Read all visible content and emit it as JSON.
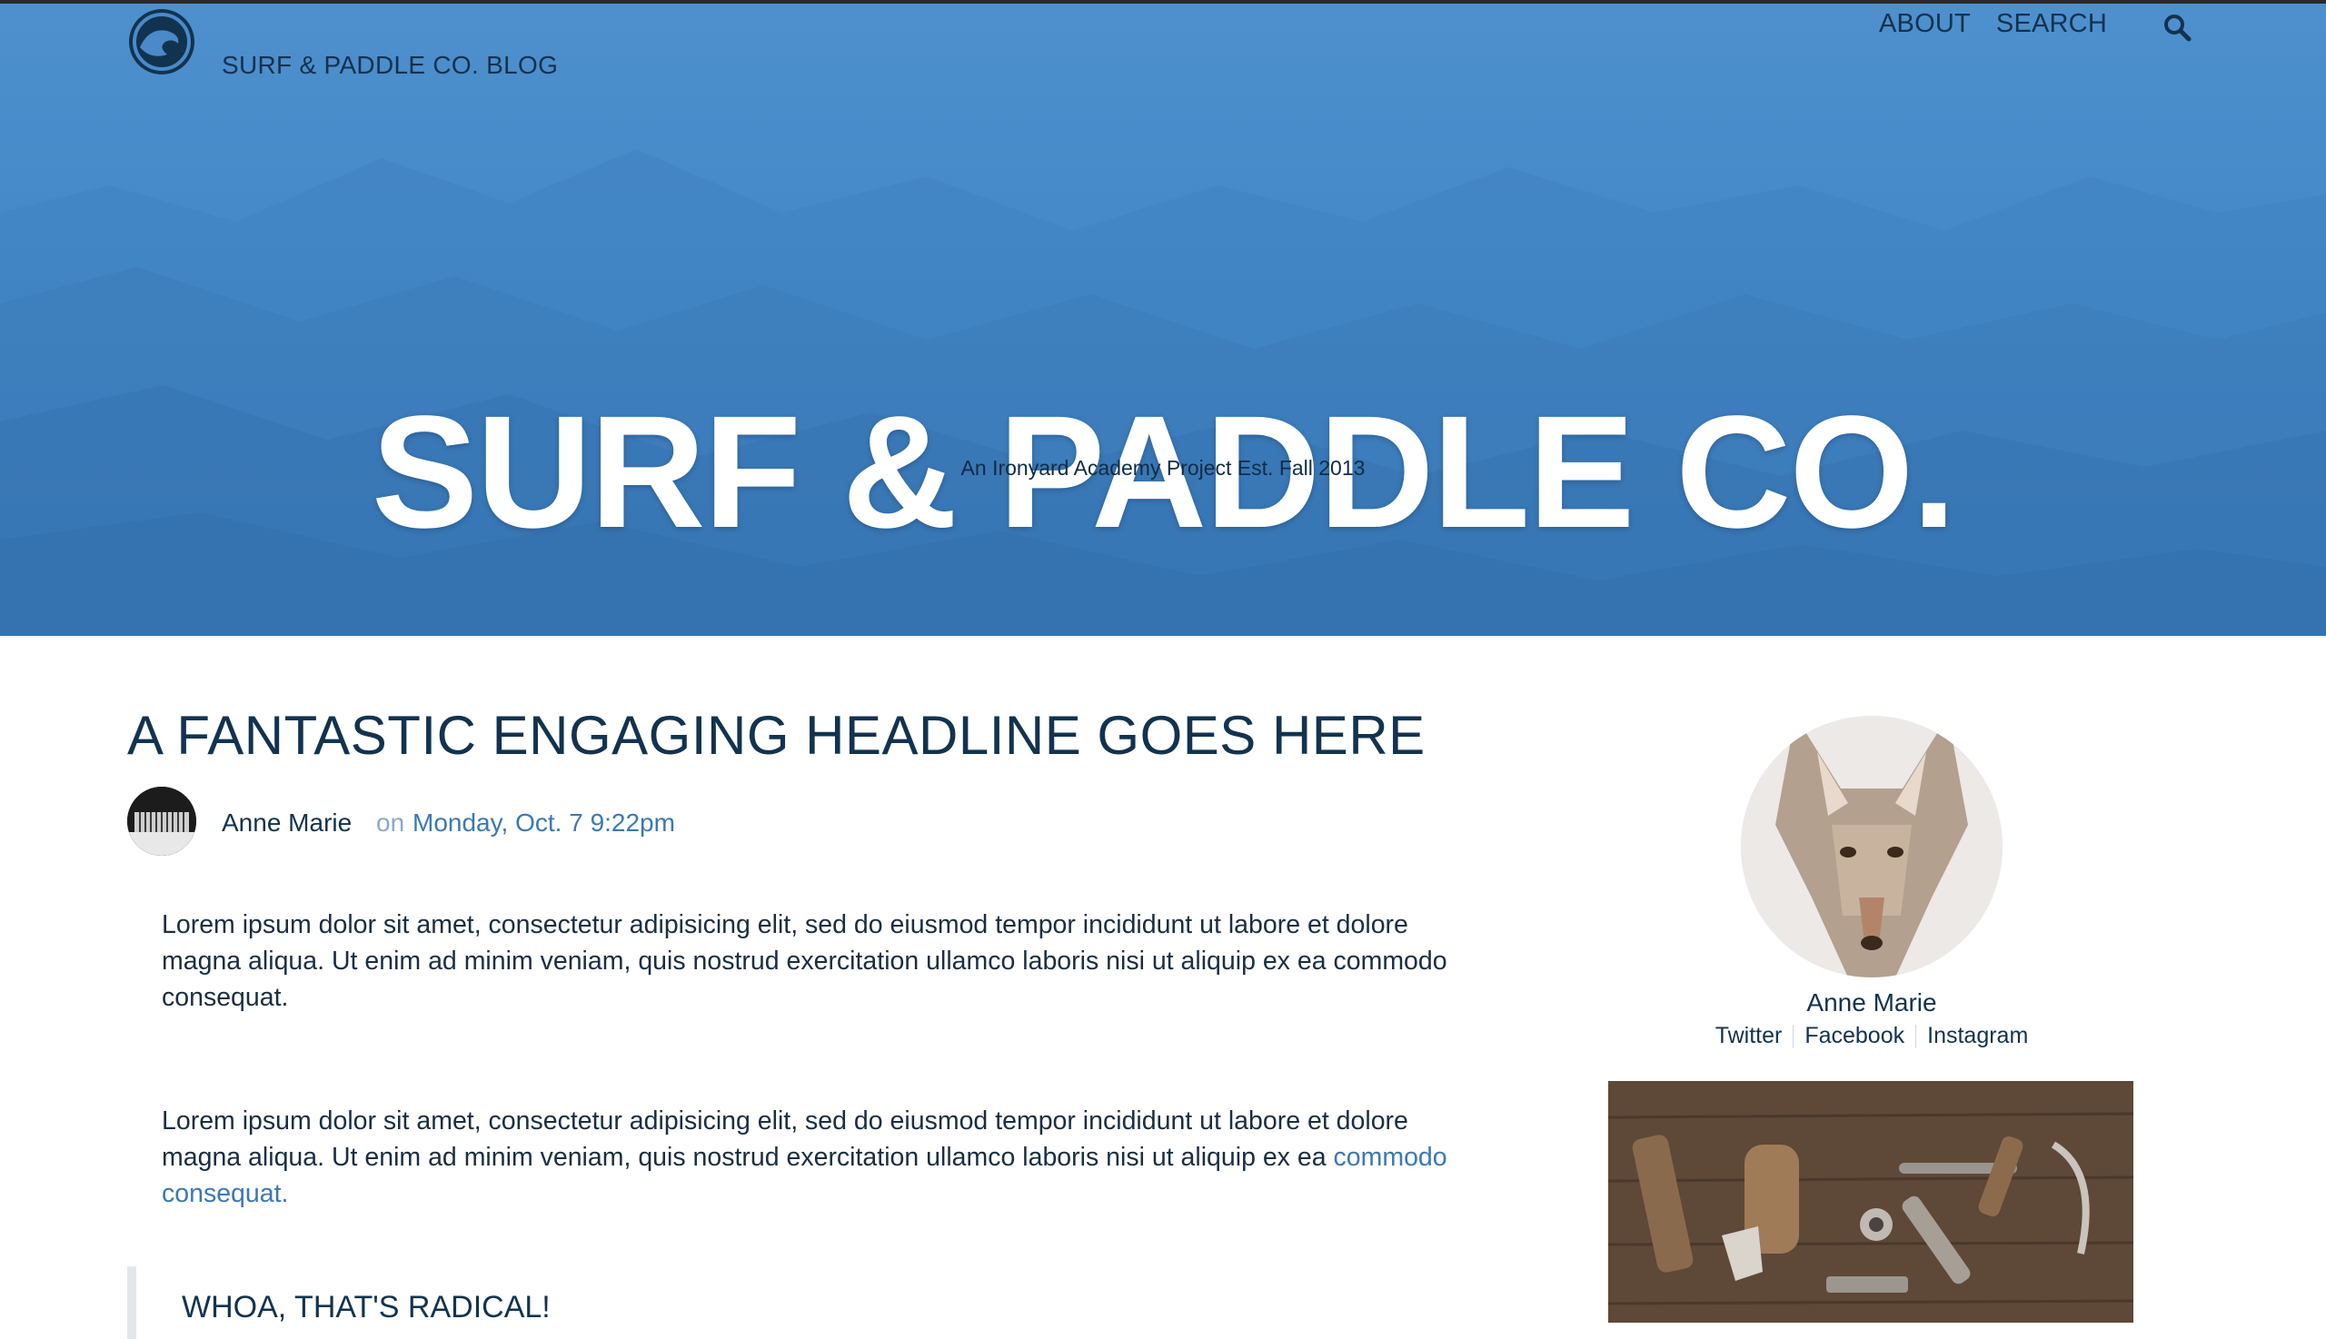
{
  "header": {
    "brand_name": "SURF & PADDLE CO. BLOG",
    "nav": [
      {
        "label": "ABOUT"
      },
      {
        "label": "SEARCH"
      }
    ],
    "search_icon": "search-icon",
    "logo_icon": "wave-logo-icon"
  },
  "hero": {
    "title": "SURF & PADDLE CO.",
    "subtitle": "An Ironyard Academy Project Est. Fall 2013"
  },
  "article": {
    "headline": "A FANTASTIC ENGAGING HEADLINE GOES HERE",
    "author": "Anne Marie",
    "on_text": "on",
    "date": "Monday, Oct. 7 9:22pm",
    "paragraph1": "Lorem ipsum dolor sit amet, consectetur adipisicing elit, sed do eiusmod tempor incididunt ut labore et dolore magna aliqua. Ut enim ad minim veniam, quis nostrud exercitation ullamco laboris nisi ut aliquip ex ea commodo consequat.",
    "paragraph2_text": "Lorem ipsum dolor sit amet, consectetur adipisicing elit, sed do eiusmod tempor incididunt ut labore et dolore magna aliqua. Ut enim ad minim veniam, quis nostrud exercitation ullamco laboris nisi ut aliquip ex ea ",
    "paragraph2_link": "commodo consequat.",
    "quote": "WHOA, THAT'S RADICAL!"
  },
  "sidebar": {
    "name": "Anne Marie",
    "links": [
      "Twitter",
      "Facebook",
      "Instagram"
    ]
  },
  "colors": {
    "hero_blue": "#4388c8",
    "navy_text": "#13324f",
    "link_blue": "#3b78b4",
    "muted_on": "#8aa9c7"
  }
}
